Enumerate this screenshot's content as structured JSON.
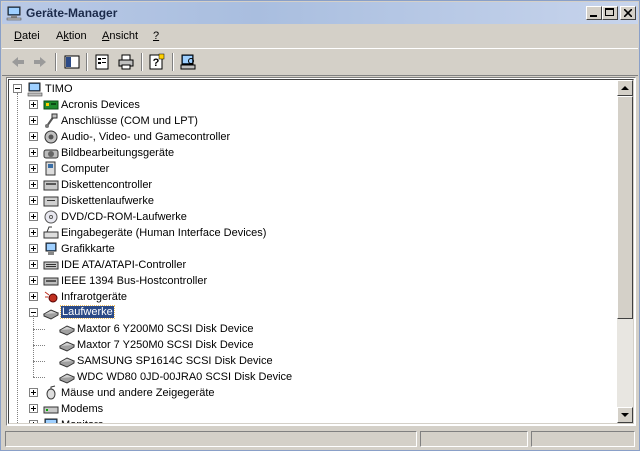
{
  "window": {
    "title": "Geräte-Manager"
  },
  "menu": [
    {
      "label": "Datei",
      "underline": "D"
    },
    {
      "label": "Aktion",
      "underline": "k"
    },
    {
      "label": "Ansicht",
      "underline": "A"
    },
    {
      "label": "?",
      "underline": "?"
    }
  ],
  "toolbar": [
    "back-arrow-icon",
    "forward-arrow-icon",
    "console-tree-icon",
    "properties-icon",
    "print-icon",
    "help-icon",
    "scan-hardware-icon"
  ],
  "tree": {
    "root": "TIMO",
    "categories": [
      {
        "label": "Acronis Devices",
        "icon": "acronis-board-icon"
      },
      {
        "label": "Anschlüsse (COM und LPT)",
        "icon": "port-icon"
      },
      {
        "label": "Audio-, Video- und Gamecontroller",
        "icon": "audio-icon"
      },
      {
        "label": "Bildbearbeitungsgeräte",
        "icon": "camera-icon"
      },
      {
        "label": "Computer",
        "icon": "computer-icon"
      },
      {
        "label": "Diskettencontroller",
        "icon": "floppy-controller-icon"
      },
      {
        "label": "Diskettenlaufwerke",
        "icon": "floppy-drive-icon"
      },
      {
        "label": "DVD/CD-ROM-Laufwerke",
        "icon": "cdrom-icon"
      },
      {
        "label": "Eingabegeräte (Human Interface Devices)",
        "icon": "hid-icon"
      },
      {
        "label": "Grafikkarte",
        "icon": "display-adapter-icon"
      },
      {
        "label": "IDE ATA/ATAPI-Controller",
        "icon": "ide-controller-icon"
      },
      {
        "label": "IEEE 1394 Bus-Hostcontroller",
        "icon": "firewire-icon"
      },
      {
        "label": "Infrarotgeräte",
        "icon": "infrared-icon"
      },
      {
        "label": "Laufwerke",
        "icon": "disk-drive-icon",
        "expanded": true,
        "selected": true,
        "children": [
          "Maxtor 6 Y200M0 SCSI Disk Device",
          "Maxtor 7 Y250M0 SCSI Disk Device",
          "SAMSUNG SP1614C SCSI Disk Device",
          "WDC WD80 0JD-00JRA0 SCSI Disk Device"
        ]
      },
      {
        "label": "Mäuse und andere Zeigegeräte",
        "icon": "mouse-icon"
      },
      {
        "label": "Modems",
        "icon": "modem-icon"
      },
      {
        "label": "Monitore",
        "icon": "monitor-icon"
      }
    ]
  }
}
